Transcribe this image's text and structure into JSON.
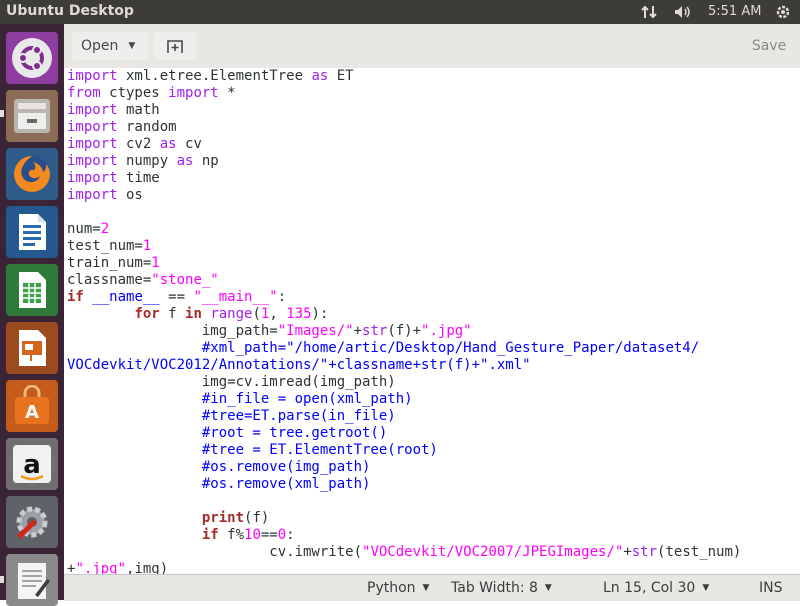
{
  "top_panel": {
    "title": "Ubuntu Desktop",
    "clock": "5:51 AM",
    "tray_icons": [
      "network-arrows-icon",
      "volume-icon",
      "power-gear-icon"
    ]
  },
  "launcher": {
    "items": [
      "ubuntu-dash-icon",
      "files-icon",
      "firefox-icon",
      "libreoffice-writer-icon",
      "libreoffice-calc-icon",
      "libreoffice-impress-icon",
      "ubuntu-software-icon",
      "amazon-icon",
      "system-settings-icon",
      "text-editor-icon"
    ]
  },
  "header": {
    "open_label": "Open",
    "save_label": "Save"
  },
  "editor": {
    "lines": [
      [
        [
          "kw",
          "import"
        ],
        [
          "t",
          " xml.etree.ElementTree "
        ],
        [
          "kw",
          "as"
        ],
        [
          "t",
          " ET"
        ]
      ],
      [
        [
          "kw",
          "from"
        ],
        [
          "t",
          " ctypes "
        ],
        [
          "kw",
          "import"
        ],
        [
          "t",
          " *"
        ]
      ],
      [
        [
          "kw",
          "import"
        ],
        [
          "t",
          " math"
        ]
      ],
      [
        [
          "kw",
          "import"
        ],
        [
          "t",
          " random"
        ]
      ],
      [
        [
          "kw",
          "import"
        ],
        [
          "t",
          " cv2 "
        ],
        [
          "kw",
          "as"
        ],
        [
          "t",
          " cv"
        ]
      ],
      [
        [
          "kw",
          "import"
        ],
        [
          "t",
          " numpy "
        ],
        [
          "kw",
          "as"
        ],
        [
          "t",
          " np"
        ]
      ],
      [
        [
          "kw",
          "import"
        ],
        [
          "t",
          " time"
        ]
      ],
      [
        [
          "kw",
          "import"
        ],
        [
          "t",
          " os"
        ]
      ],
      [],
      [
        [
          "t",
          "num="
        ],
        [
          "num",
          "2"
        ]
      ],
      [
        [
          "t",
          "test_num="
        ],
        [
          "num",
          "1"
        ]
      ],
      [
        [
          "t",
          "train_num="
        ],
        [
          "num",
          "1"
        ]
      ],
      [
        [
          "t",
          "classname="
        ],
        [
          "str",
          "\"stone_\""
        ]
      ],
      [
        [
          "kwb",
          "if"
        ],
        [
          "t",
          " "
        ],
        [
          "dunder",
          "__name__"
        ],
        [
          "t",
          " == "
        ],
        [
          "str",
          "\"__main__\""
        ],
        [
          "t",
          ":"
        ]
      ],
      [
        [
          "t",
          "        "
        ],
        [
          "kwb",
          "for"
        ],
        [
          "t",
          " f "
        ],
        [
          "kwb",
          "in"
        ],
        [
          "t",
          " "
        ],
        [
          "bi",
          "range"
        ],
        [
          "t",
          "("
        ],
        [
          "num",
          "1"
        ],
        [
          "t",
          ", "
        ],
        [
          "num",
          "135"
        ],
        [
          "t",
          "):"
        ]
      ],
      [
        [
          "t",
          "                img_path="
        ],
        [
          "str",
          "\"Images/\""
        ],
        [
          "t",
          "+"
        ],
        [
          "bi",
          "str"
        ],
        [
          "t",
          "(f)+"
        ],
        [
          "str",
          "\".jpg\""
        ]
      ],
      [
        [
          "t",
          "                "
        ],
        [
          "cmt",
          "#xml_path=\"/home/artic/Desktop/Hand_Gesture_Paper/dataset4/"
        ]
      ],
      [
        [
          "cmt",
          "VOCdevkit/VOC2012/Annotations/\"+classname+str(f)+\".xml\""
        ]
      ],
      [
        [
          "t",
          "                img=cv.imread(img_path)"
        ]
      ],
      [
        [
          "t",
          "                "
        ],
        [
          "cmt",
          "#in_file = open(xml_path)"
        ]
      ],
      [
        [
          "t",
          "                "
        ],
        [
          "cmt",
          "#tree=ET.parse(in_file)"
        ]
      ],
      [
        [
          "t",
          "                "
        ],
        [
          "cmt",
          "#root = tree.getroot()"
        ]
      ],
      [
        [
          "t",
          "                "
        ],
        [
          "cmt",
          "#tree = ET.ElementTree(root)"
        ]
      ],
      [
        [
          "t",
          "                "
        ],
        [
          "cmt",
          "#os.remove(img_path)"
        ]
      ],
      [
        [
          "t",
          "                "
        ],
        [
          "cmt",
          "#os.remove(xml_path)"
        ]
      ],
      [],
      [
        [
          "t",
          "                "
        ],
        [
          "kwb",
          "print"
        ],
        [
          "t",
          "(f)"
        ]
      ],
      [
        [
          "t",
          "                "
        ],
        [
          "kwb",
          "if"
        ],
        [
          "t",
          " f%"
        ],
        [
          "num",
          "10"
        ],
        [
          "t",
          "=="
        ],
        [
          "num",
          "0"
        ],
        [
          "t",
          ":"
        ]
      ],
      [
        [
          "t",
          "                        cv.imwrite("
        ],
        [
          "str",
          "\"VOCdevkit/VOC2007/JPEGImages/\""
        ],
        [
          "t",
          "+"
        ],
        [
          "bi",
          "str"
        ],
        [
          "t",
          "(test_num)"
        ]
      ],
      [
        [
          "t",
          "+"
        ],
        [
          "str",
          "\".jpg\""
        ],
        [
          "t",
          ",img)"
        ]
      ]
    ]
  },
  "statusbar": {
    "language": "Python",
    "tab_width": "Tab Width: 8",
    "position": "Ln 15, Col 30",
    "mode": "INS"
  }
}
